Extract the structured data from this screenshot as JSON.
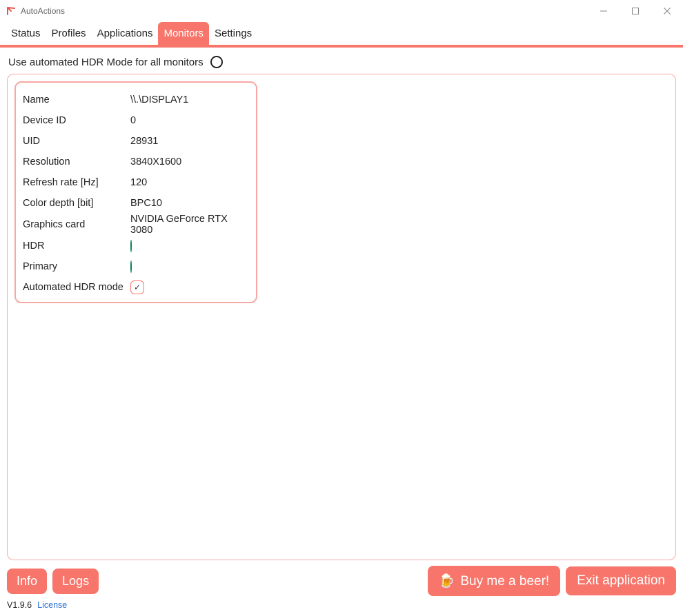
{
  "window": {
    "title": "AutoActions"
  },
  "tabs": [
    "Status",
    "Profiles",
    "Applications",
    "Monitors",
    "Settings"
  ],
  "active_tab_index": 3,
  "toggle": {
    "label": "Use automated HDR Mode for all monitors"
  },
  "monitor": {
    "rows": [
      {
        "label": "Name",
        "value": "\\\\.\\DISPLAY1"
      },
      {
        "label": "Device ID",
        "value": "0"
      },
      {
        "label": "UID",
        "value": "28931"
      },
      {
        "label": "Resolution",
        "value": "3840X1600"
      },
      {
        "label": "Refresh rate [Hz]",
        "value": "120"
      },
      {
        "label": "Color depth [bit]",
        "value": "BPC10"
      },
      {
        "label": "Graphics card",
        "value": "NVIDIA GeForce RTX 3080"
      }
    ],
    "hdr_label": "HDR",
    "primary_label": "Primary",
    "auto_hdr_label": "Automated HDR mode",
    "auto_hdr_checked": "✓"
  },
  "buttons": {
    "info": "Info",
    "logs": "Logs",
    "beer": "Buy me a beer!",
    "exit": "Exit application"
  },
  "footer": {
    "version": "V1.9.6",
    "license": "License"
  }
}
